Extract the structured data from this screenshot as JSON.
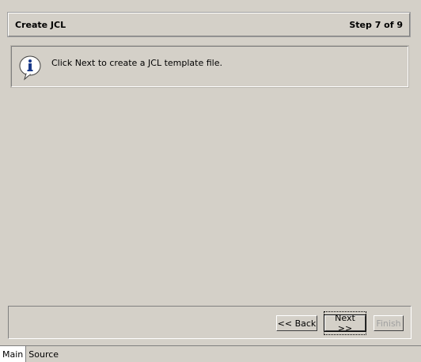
{
  "header": {
    "title": "Create JCL",
    "step": "Step 7 of 9"
  },
  "info": {
    "icon": "info-icon",
    "message": "Click Next to create a JCL template file."
  },
  "buttons": {
    "back": "<< Back",
    "next": "Next >>",
    "finish": "Finish"
  },
  "tabs": [
    {
      "label": "Main",
      "active": true
    },
    {
      "label": "Source",
      "active": false
    }
  ],
  "colors": {
    "background": "#d4d0c8",
    "icon_blue": "#1a3a8a",
    "disabled_text": "#a0a0a0"
  }
}
